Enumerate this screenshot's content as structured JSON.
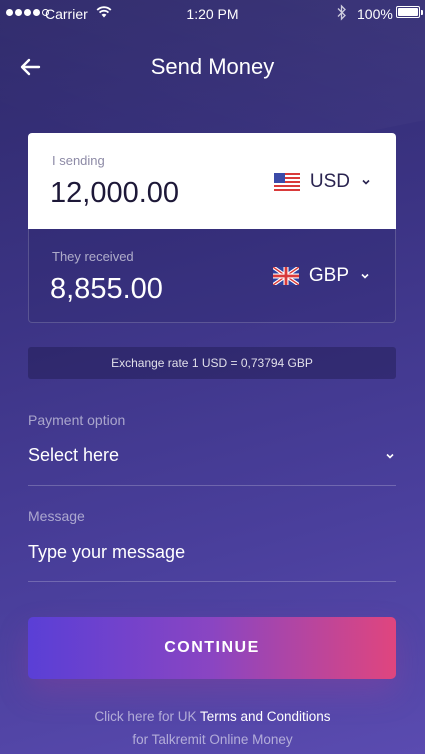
{
  "status_bar": {
    "carrier": "Carrier",
    "time": "1:20 PM",
    "battery": "100%"
  },
  "header": {
    "title": "Send Money",
    "back_icon": "arrow-left-icon"
  },
  "send": {
    "label": "I sending",
    "amount": "12,000.00",
    "currency": "USD",
    "flag": "us-flag-icon"
  },
  "receive": {
    "label": "They received",
    "amount": "8,855.00",
    "currency": "GBP",
    "flag": "uk-flag-icon"
  },
  "exchange_rate": "Exchange rate 1 USD = 0,73794 GBP",
  "payment": {
    "label": "Payment option",
    "value": "Select here"
  },
  "message": {
    "label": "Message",
    "placeholder": "Type your message"
  },
  "continue_label": "CONTINUE",
  "footer": {
    "line1_prefix": "Click here for UK ",
    "line1_link": "Terms and Conditions",
    "line2": "for Talkremit Online Money"
  },
  "colors": {
    "background_top": "#2f2a6b",
    "background_bottom": "#5a4bb0",
    "button_gradient_start": "#5a3fd6",
    "button_gradient_end": "#e0457e"
  }
}
